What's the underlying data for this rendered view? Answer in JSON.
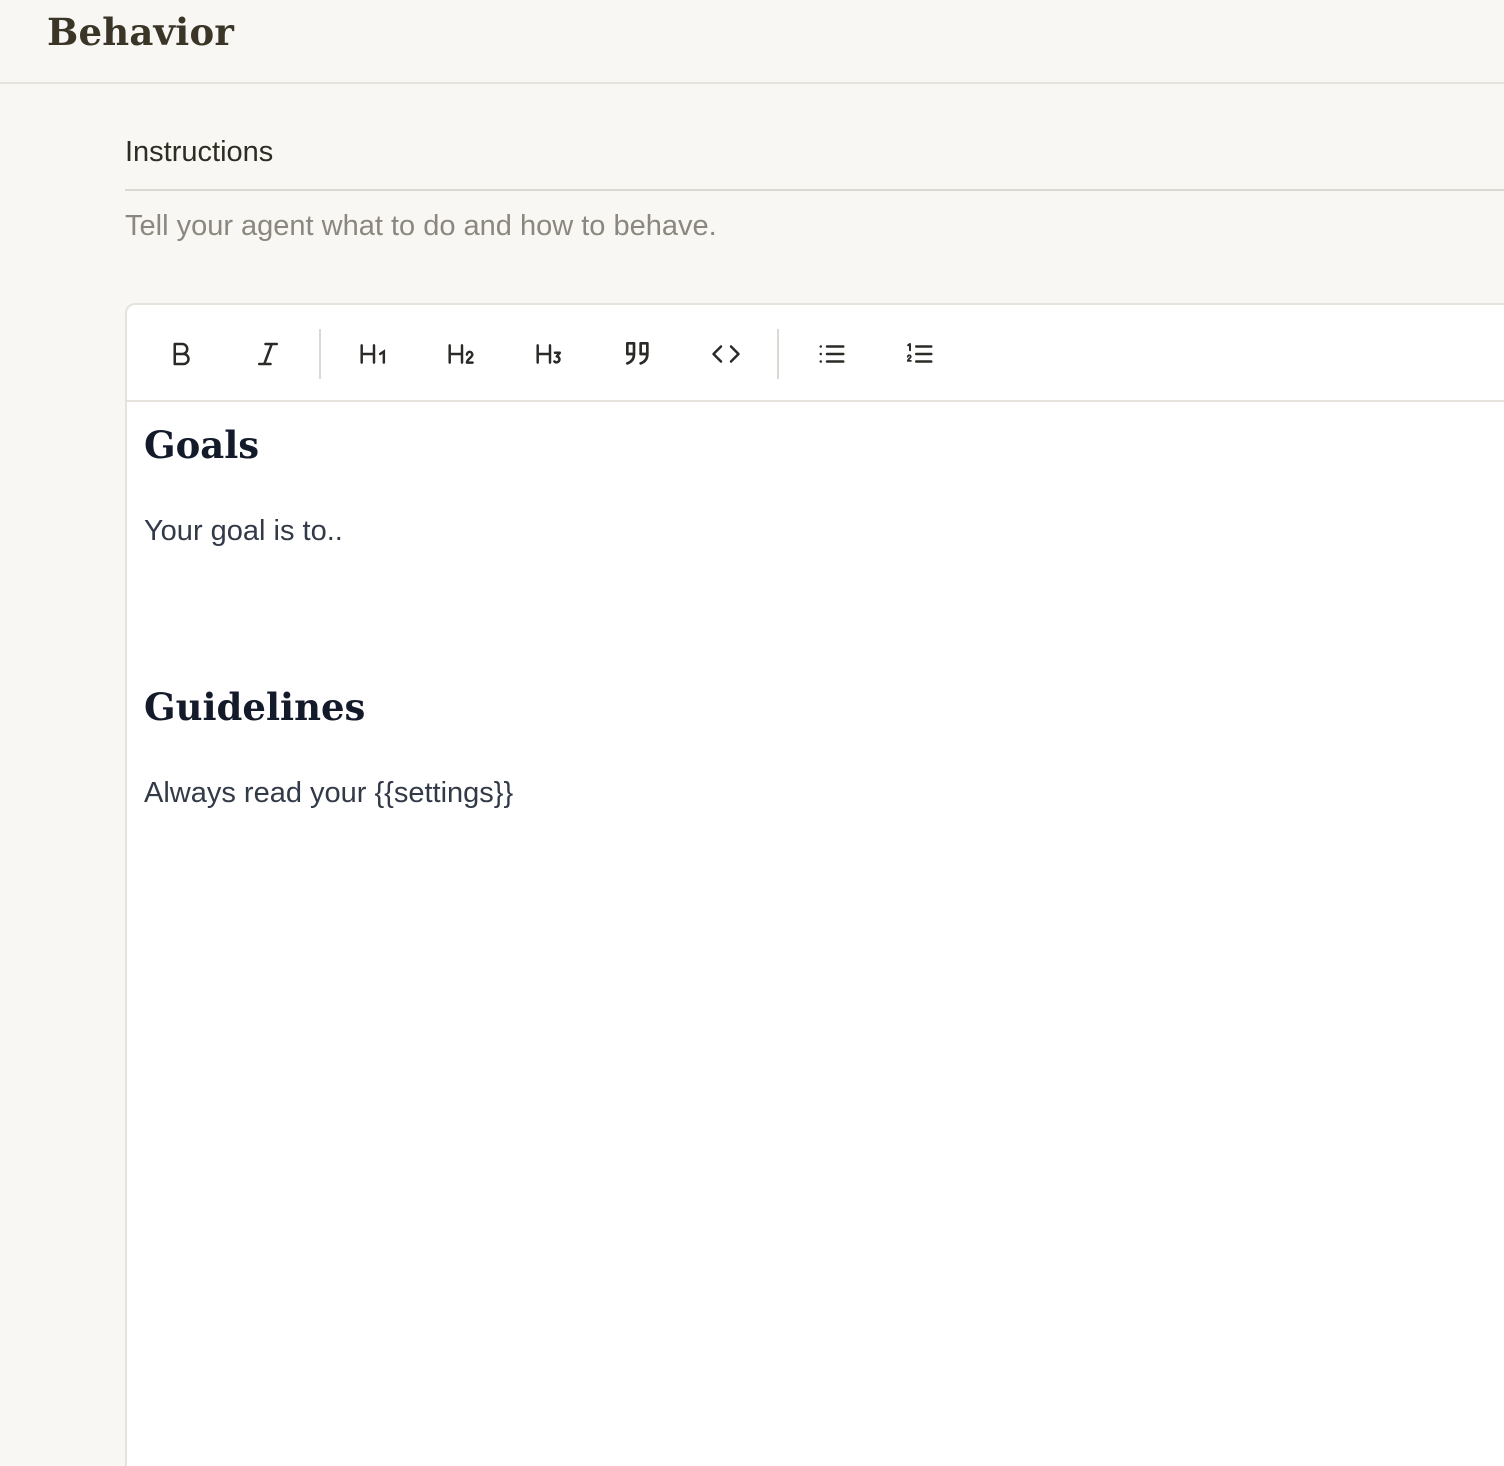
{
  "header": {
    "title": "Behavior"
  },
  "instructions": {
    "label": "Instructions",
    "description": "Tell your agent what to do and how to behave."
  },
  "toolbar": {
    "buttons": [
      {
        "name": "bold-button",
        "icon": "bold-icon",
        "glyph": "B"
      },
      {
        "name": "italic-button",
        "icon": "italic-icon",
        "glyph": "I"
      },
      {
        "name": "heading1-button",
        "icon": "heading1-icon",
        "glyph": "H1"
      },
      {
        "name": "heading2-button",
        "icon": "heading2-icon",
        "glyph": "H2"
      },
      {
        "name": "heading3-button",
        "icon": "heading3-icon",
        "glyph": "H3"
      },
      {
        "name": "blockquote-button",
        "icon": "quote-icon"
      },
      {
        "name": "code-button",
        "icon": "code-icon"
      },
      {
        "name": "bullet-list-button",
        "icon": "bullet-list-icon"
      },
      {
        "name": "ordered-list-button",
        "icon": "ordered-list-icon"
      }
    ]
  },
  "document": {
    "heading_goals": "Goals",
    "paragraph_goals": "Your goal is to..",
    "heading_guidelines": "Guidelines",
    "paragraph_guidelines": "Always read your {{settings}}"
  },
  "colors": {
    "background": "#f8f7f3",
    "editor_bg": "#ffffff",
    "title": "#3a3526",
    "heading": "#131a2a",
    "body_text": "#333a47",
    "muted": "#8b877f",
    "border": "#e6e3dc"
  }
}
